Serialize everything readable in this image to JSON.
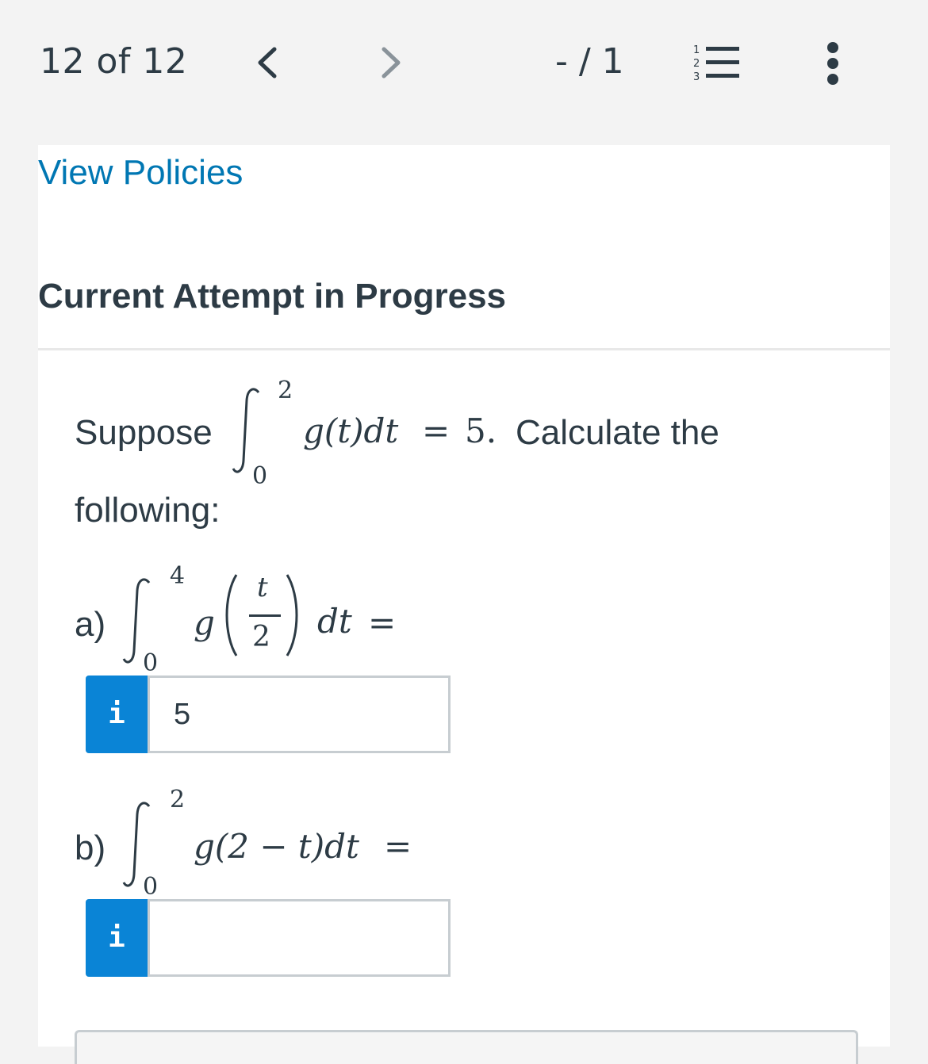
{
  "header": {
    "question_count": "12 of 12",
    "prev_icon": "chevron-left-icon",
    "next_icon": "chevron-right-icon",
    "score": "- / 1",
    "question_list_icon": "numbered-list-icon",
    "more_icon": "kebab-menu-icon"
  },
  "links": {
    "view_policies": "View Policies"
  },
  "status": {
    "attempt": "Current Attempt in Progress"
  },
  "question": {
    "intro_text": "Suppose",
    "given_integral": {
      "lower": "0",
      "upper": "2",
      "integrand": "g(t)dt",
      "equals": "=",
      "value": "5.",
      "tail": "Calculate the"
    },
    "intro_continue": "following:",
    "parts": [
      {
        "label": "a)",
        "lower": "0",
        "upper": "4",
        "integrand_fn": "g",
        "frac_num": "t",
        "frac_den": "2",
        "differential": "dt",
        "equals": "=",
        "answer_value": "5",
        "info_label": "i"
      },
      {
        "label": "b)",
        "lower": "0",
        "upper": "2",
        "integrand": "g(2 − t)dt",
        "equals": "=",
        "answer_value": "",
        "info_label": "i"
      }
    ]
  },
  "colors": {
    "accent": "#0a84d6",
    "link": "#0077b3",
    "text": "#2d3b45"
  }
}
